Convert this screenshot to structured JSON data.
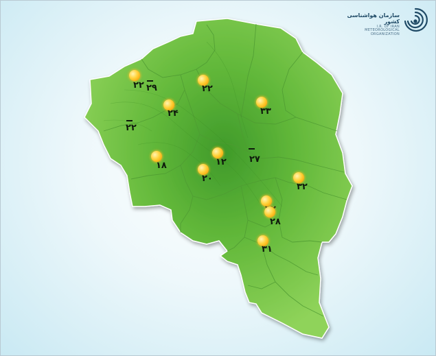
{
  "logo": {
    "name_fa": "سازمان هواشناسی کشور",
    "name_en_line1": "I.R. OF IRAN",
    "name_en_line2": "METEOROLOGICAL",
    "name_en_line3": "ORGANIZATION"
  },
  "colors": {
    "background": "#dff3f8",
    "province_fill": "#6fbf3a",
    "province_border": "#ffffff",
    "sun": "#ffc21f",
    "temperature_text": "#0f1a0c"
  },
  "stations": [
    {
      "id": "s1",
      "temp": "۲۲",
      "has_sun": true
    },
    {
      "id": "s2",
      "temp": "۲۹",
      "has_sun": false
    },
    {
      "id": "s3",
      "temp": "۲۲",
      "has_sun": false
    },
    {
      "id": "s4",
      "temp": "۲۴",
      "has_sun": true
    },
    {
      "id": "s5",
      "temp": "۲۲",
      "has_sun": true
    },
    {
      "id": "s6",
      "temp": "۳۳",
      "has_sun": true
    },
    {
      "id": "s7",
      "temp": "۱۸",
      "has_sun": true
    },
    {
      "id": "s8",
      "temp": "۱۲",
      "has_sun": true
    },
    {
      "id": "s9",
      "temp": "۲۰",
      "has_sun": true
    },
    {
      "id": "s10",
      "temp": "۲۷",
      "has_sun": false
    },
    {
      "id": "s11",
      "temp": "۳۲",
      "has_sun": true
    },
    {
      "id": "s12",
      "temp": "۳۲",
      "has_sun": true
    },
    {
      "id": "s13",
      "temp": "۲۸",
      "has_sun": true
    },
    {
      "id": "s14",
      "temp": "۳۱",
      "has_sun": true
    }
  ]
}
